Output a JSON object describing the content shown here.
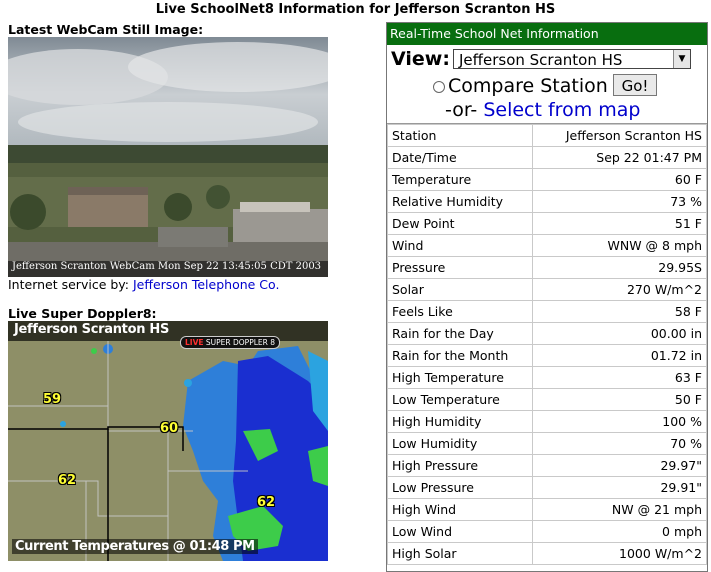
{
  "page": {
    "title": "Live SchoolNet8 Information for Jefferson Scranton HS"
  },
  "webcam": {
    "label": "Latest WebCam Still Image:",
    "caption": "Jefferson Scranton WebCam Mon Sep 22 13:45:05 CDT 2003",
    "credit_prefix": "Internet service by: ",
    "credit_link": "Jefferson Telephone Co."
  },
  "doppler": {
    "label": "Live Super Doppler8:",
    "title": "Jefferson Scranton HS",
    "badge_live": "LIVE",
    "badge_text": " SUPER DOPPLER 8",
    "footer": "Current Temperatures @ 01:48 PM",
    "temps": [
      "59",
      "60",
      "62",
      "62"
    ]
  },
  "panel": {
    "header": "Real-Time School Net Information",
    "view_label": "View:",
    "selected_station": "Jefferson Scranton HS",
    "compare_label": "Compare Station",
    "go_label": "Go!",
    "or_text": "-or- ",
    "map_link": "Select from map",
    "rows": [
      {
        "label": "Station",
        "value": "Jefferson Scranton HS"
      },
      {
        "label": "Date/Time",
        "value": "Sep 22 01:47 PM"
      },
      {
        "label": "Temperature",
        "value": "60 F"
      },
      {
        "label": "Relative Humidity",
        "value": "73 %"
      },
      {
        "label": "Dew Point",
        "value": "51 F"
      },
      {
        "label": "Wind",
        "value": "WNW @ 8 mph"
      },
      {
        "label": "Pressure",
        "value": "29.95S"
      },
      {
        "label": "Solar",
        "value": "270 W/m^2"
      },
      {
        "label": "Feels Like",
        "value": "58 F"
      },
      {
        "label": "Rain for the Day",
        "value": "00.00 in"
      },
      {
        "label": "Rain for the Month",
        "value": "01.72 in"
      },
      {
        "label": "High Temperature",
        "value": "63 F"
      },
      {
        "label": "Low Temperature",
        "value": "50 F"
      },
      {
        "label": "High Humidity",
        "value": "100 %"
      },
      {
        "label": "Low Humidity",
        "value": "70 %"
      },
      {
        "label": "High Pressure",
        "value": "29.97\""
      },
      {
        "label": "Low Pressure",
        "value": "29.91\""
      },
      {
        "label": "High Wind",
        "value": "NW @ 21 mph"
      },
      {
        "label": "Low Wind",
        "value": "0 mph"
      },
      {
        "label": "High Solar",
        "value": "1000 W/m^2"
      }
    ]
  }
}
